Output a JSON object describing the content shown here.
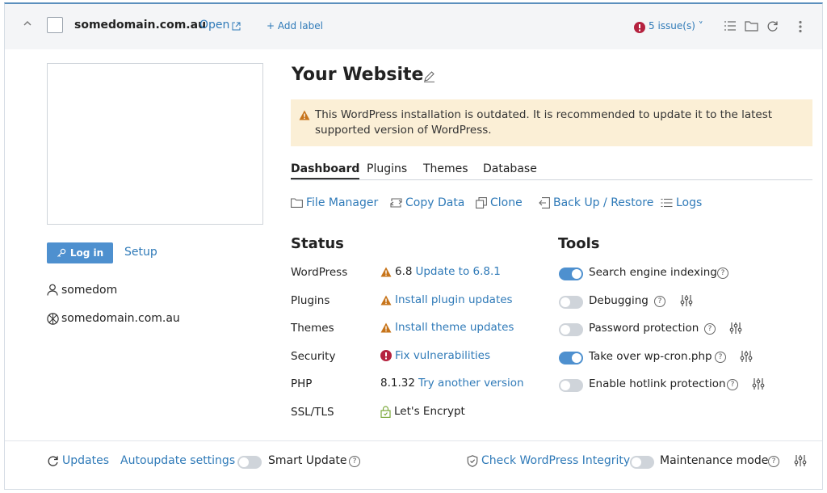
{
  "header": {
    "domain": "somedomain.com.au",
    "open_label": "Open",
    "add_label": "+ Add label",
    "issues_label": "5 issue(s)"
  },
  "sidebar": {
    "login_label": "Log in",
    "setup_label": "Setup",
    "user": "somedom",
    "site": "somedomain.com.au"
  },
  "main": {
    "title": "Your Website",
    "warning": "This WordPress installation is outdated. It is recommended to update it to the latest supported version of WordPress.",
    "tabs": [
      "Dashboard",
      "Plugins",
      "Themes",
      "Database"
    ],
    "actions": [
      "File Manager",
      "Copy Data",
      "Clone",
      "Back Up / Restore",
      "Logs"
    ]
  },
  "status": {
    "heading": "Status",
    "rows": [
      {
        "label": "WordPress",
        "value": "6.8",
        "link": "Update to 6.8.1"
      },
      {
        "label": "Plugins",
        "value": "",
        "link": "Install plugin updates"
      },
      {
        "label": "Themes",
        "value": "",
        "link": "Install theme updates"
      },
      {
        "label": "Security",
        "value": "",
        "link": "Fix vulnerabilities"
      },
      {
        "label": "PHP",
        "value": "8.1.32",
        "link": "Try another version"
      },
      {
        "label": "SSL/TLS",
        "value": "Let's Encrypt",
        "link": ""
      }
    ]
  },
  "tools": {
    "heading": "Tools",
    "items": [
      {
        "label": "Search engine indexing",
        "on": true
      },
      {
        "label": "Debugging",
        "on": false
      },
      {
        "label": "Password protection",
        "on": false
      },
      {
        "label": "Take over wp-cron.php",
        "on": true
      },
      {
        "label": "Enable hotlink protection",
        "on": false
      }
    ]
  },
  "footer": {
    "updates": "Updates",
    "autoupdate": "Autoupdate settings",
    "smart_update": "Smart Update",
    "check_integrity": "Check WordPress Integrity",
    "maintenance": "Maintenance mode"
  },
  "colors": {
    "accent": "#2f7ab8",
    "warning": "#c7741a",
    "danger": "#b5223f",
    "toggle_on": "#4e90cf"
  }
}
